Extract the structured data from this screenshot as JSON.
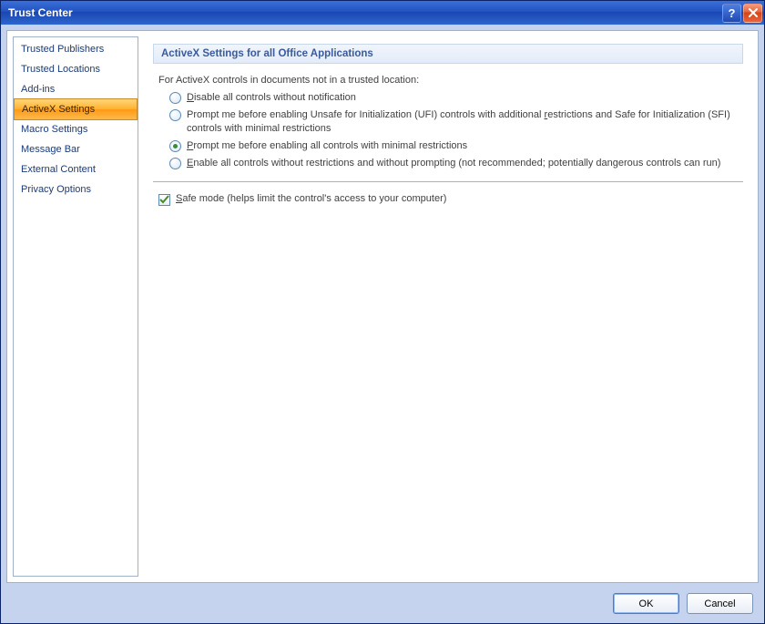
{
  "window": {
    "title": "Trust Center"
  },
  "sidebar": {
    "items": [
      {
        "label": "Trusted Publishers",
        "selected": false
      },
      {
        "label": "Trusted Locations",
        "selected": false
      },
      {
        "label": "Add-ins",
        "selected": false
      },
      {
        "label": "ActiveX Settings",
        "selected": true
      },
      {
        "label": "Macro Settings",
        "selected": false
      },
      {
        "label": "Message Bar",
        "selected": false
      },
      {
        "label": "External Content",
        "selected": false
      },
      {
        "label": "Privacy Options",
        "selected": false
      }
    ]
  },
  "content": {
    "section_header": "ActiveX Settings for all Office Applications",
    "intro": "For ActiveX controls in documents not in a trusted location:",
    "radios": [
      {
        "mn": "D",
        "rest": "isable all controls without notification",
        "checked": false
      },
      {
        "mn": "",
        "rest": "Prompt me before enabling Unsafe for Initialization (UFI) controls with additional ",
        "mn2": "r",
        "rest2": "estrictions and Safe for Initialization (SFI) controls with minimal restrictions",
        "checked": false
      },
      {
        "mn": "P",
        "rest": "rompt me before enabling all controls with minimal restrictions",
        "checked": true
      },
      {
        "mn": "E",
        "rest": "nable all controls without restrictions and without prompting (not recommended; potentially dangerous controls can run)",
        "checked": false
      }
    ],
    "checkbox": {
      "mn": "S",
      "rest": "afe mode (helps limit the control's access to your computer)",
      "checked": true
    }
  },
  "buttons": {
    "ok": "OK",
    "cancel": "Cancel"
  }
}
